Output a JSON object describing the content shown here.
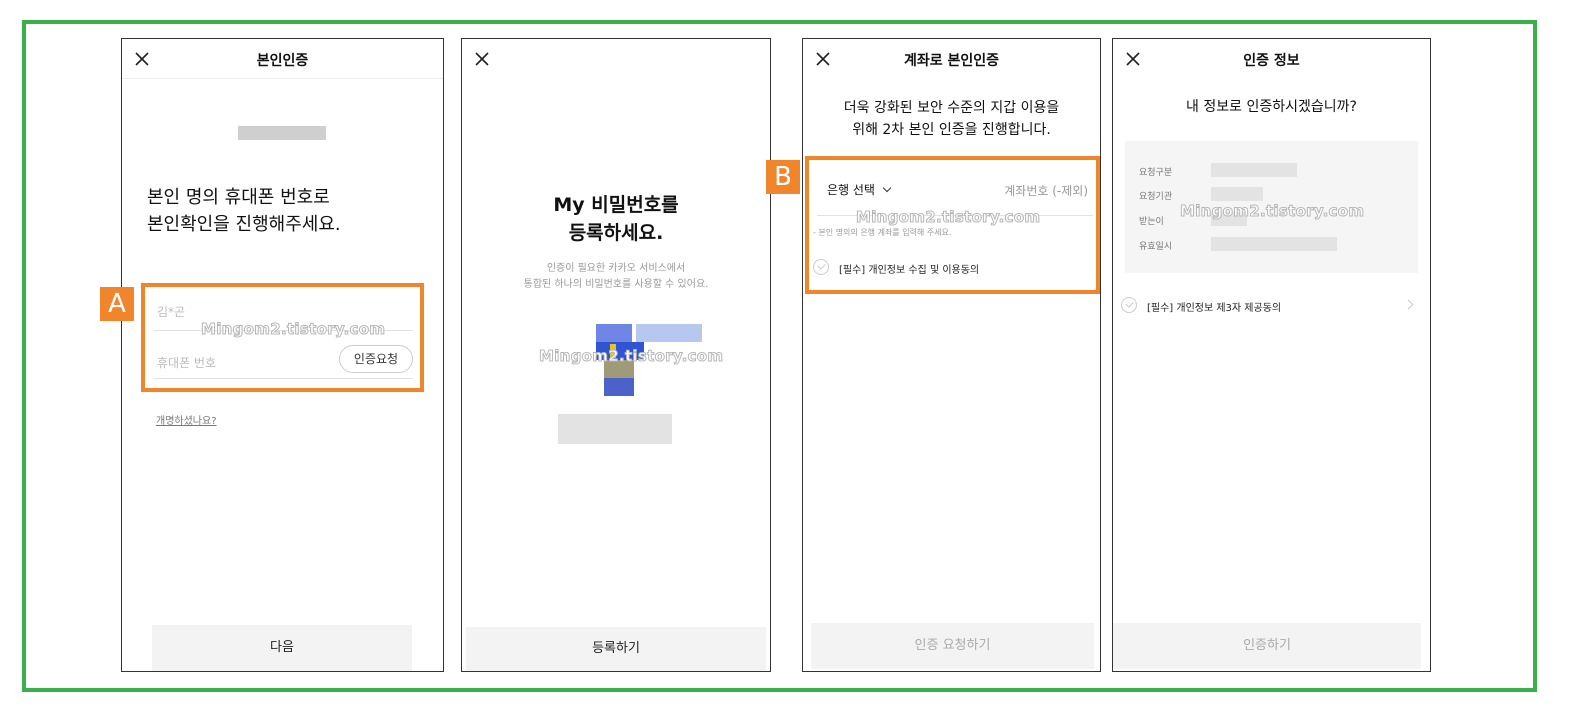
{
  "screens": {
    "verify": {
      "title": "본인인증",
      "heading_line1": "본인 명의 휴대폰 번호로",
      "heading_line2": "본인확인을 진행해주세요.",
      "name_value": "김*곤",
      "phone_placeholder": "휴대폰 번호",
      "request_button": "인증요청",
      "rename_link": "개명하셨나요?",
      "next_button": "다음"
    },
    "password": {
      "heading_line1": "My 비밀번호를",
      "heading_line2": "등록하세요.",
      "desc_line1": "인증이 필요한 카카오 서비스에서",
      "desc_line2": "통합된 하나의 비밀번호를 사용할 수 있어요.",
      "register_button": "등록하기"
    },
    "account": {
      "title": "계좌로 본인인증",
      "desc_line1": "더욱 강화된 보안 수준의 지갑 이용을",
      "desc_line2": "위해 2차 본인 인증을 진행합니다.",
      "bank_select": "은행 선택",
      "account_placeholder": "계좌번호 (-제외)",
      "hint": "- 본인 명의의 은행 계좌를 입력해 주세요.",
      "agree_label": "[필수] 개인정보 수집 및 이용동의",
      "request_button": "인증 요청하기"
    },
    "info": {
      "title": "인증 정보",
      "question": "내 정보로 인증하시겠습니까?",
      "fields": [
        "요청구분",
        "요청기관",
        "받는이",
        "유효일시"
      ],
      "agree_label": "[필수] 개인정보 제3자 제공동의",
      "verify_button": "인증하기"
    }
  },
  "callouts": {
    "a": "A",
    "b": "B"
  },
  "watermark": "Mingom2.tistory.com",
  "colors": {
    "frame": "#3ab04a",
    "callout": "#f0852b"
  }
}
